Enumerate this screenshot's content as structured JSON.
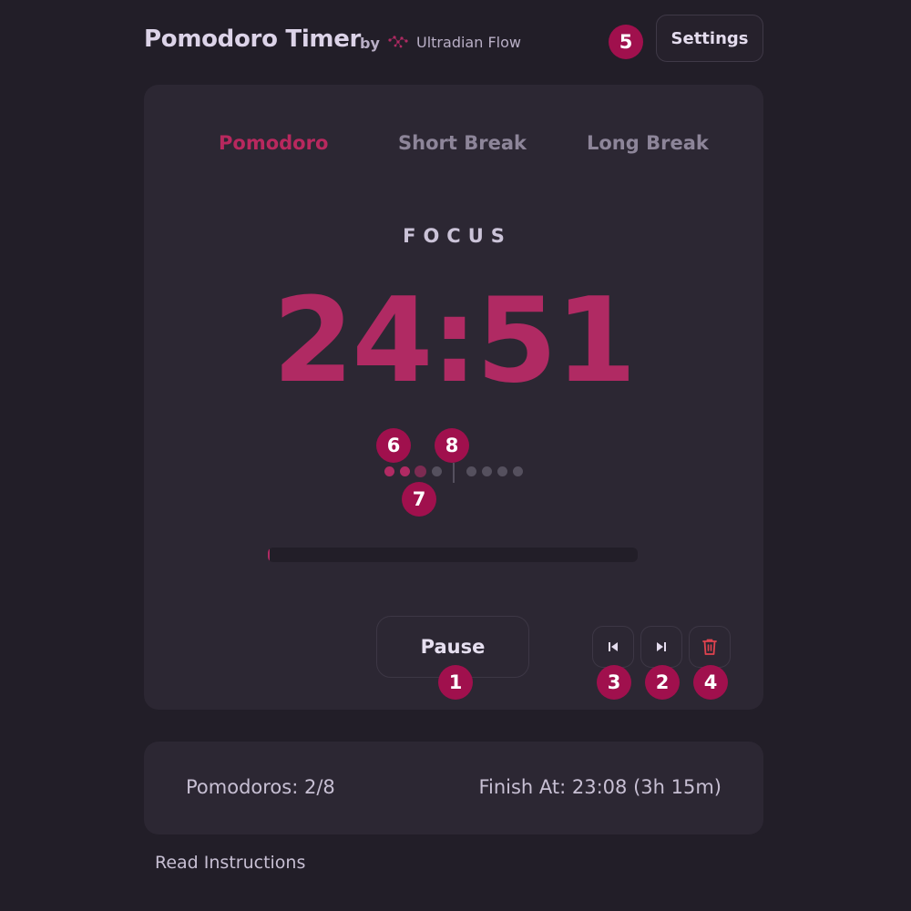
{
  "header": {
    "title": "Pomodoro Timer",
    "by": "by",
    "brand_name": "Ultradian Flow",
    "settings_label": "Settings"
  },
  "tabs": [
    {
      "label": "Pomodoro",
      "active": true
    },
    {
      "label": "Short Break",
      "active": false
    },
    {
      "label": "Long Break",
      "active": false
    }
  ],
  "timer": {
    "mode_label": "FOCUS",
    "time": "24:51",
    "progress_fraction": 0.006
  },
  "sessions": {
    "completed": 2,
    "current": 3,
    "total": 8
  },
  "controls": {
    "pause_label": "Pause",
    "prev_icon": "skip-previous-icon",
    "next_icon": "skip-next-icon",
    "delete_icon": "trash-icon"
  },
  "stats": {
    "pomodoros": "Pomodoros: 2/8",
    "finish_at": "Finish At: 23:08 (3h 15m)"
  },
  "footer": {
    "instructions_label": "Read Instructions"
  },
  "markers": {
    "m1": "1",
    "m2": "2",
    "m3": "3",
    "m4": "4",
    "m5": "5",
    "m6": "6",
    "m7": "7",
    "m8": "8"
  },
  "colors": {
    "accent": "#b02a63",
    "background": "#221e28",
    "card": "#2c2733",
    "marker": "#a0104d",
    "danger": "#e0434f"
  }
}
